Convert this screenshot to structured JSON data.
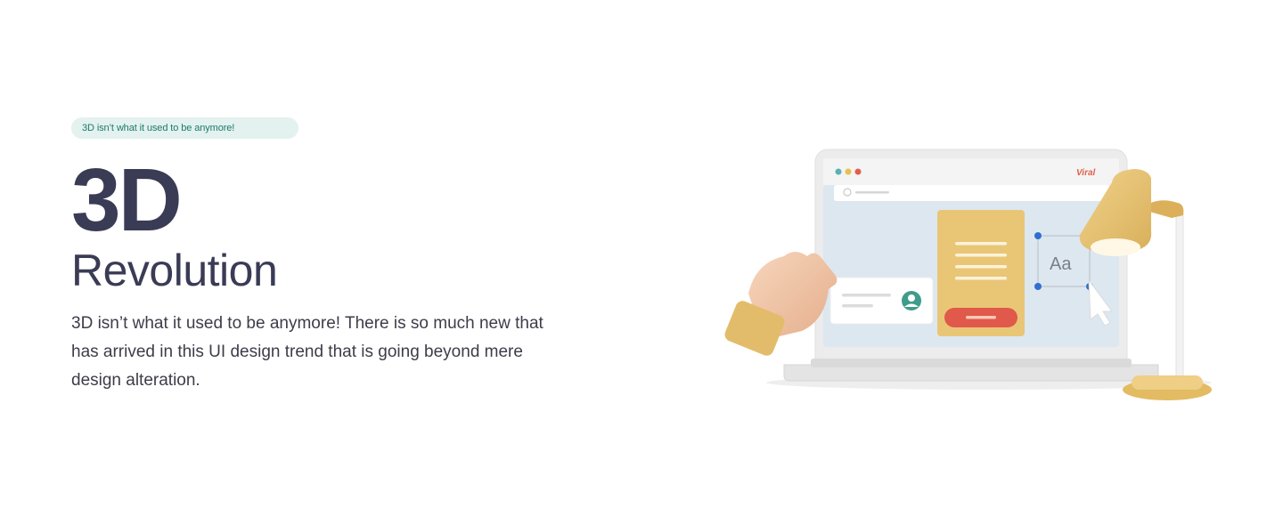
{
  "hero": {
    "badge": "3D isn’t what it used to be anymore!",
    "title_main": "3D",
    "title_sub": "Revolution",
    "description": "3D isn’t what it used to be anymore! There is so much new that has arrived in this UI design trend that is going beyond mere design alteration."
  },
  "illustration": {
    "brand_logo_text": "Viral",
    "type_sample": "Aa",
    "colors": {
      "accent_yellow": "#e9c676",
      "button_red": "#e0594a",
      "screen_bg": "#dde7f0",
      "avatar_teal": "#3f9c8c",
      "dot_red": "#e05f4c",
      "dot_yellow": "#e8c04d",
      "dot_teal": "#5bb0b4",
      "handle_blue": "#2f6fcf"
    }
  }
}
